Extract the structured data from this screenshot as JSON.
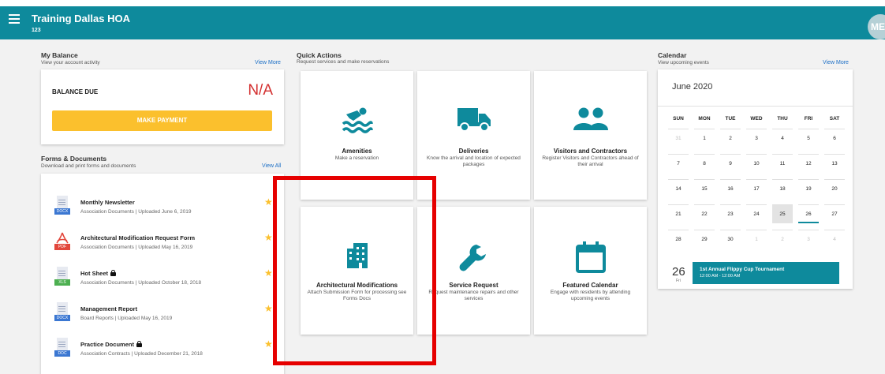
{
  "header": {
    "title": "Training Dallas HOA",
    "subtitle": "123",
    "avatar_initials": "ME"
  },
  "balance": {
    "title": "My Balance",
    "subtitle": "View your account activity",
    "link": "View More",
    "label": "BALANCE DUE",
    "value": "N/A",
    "button": "MAKE PAYMENT"
  },
  "forms": {
    "title": "Forms & Documents",
    "subtitle": "Download and print forms and documents",
    "link": "View All",
    "items": [
      {
        "title": "Monthly Newsletter",
        "meta": "Association Documents | Uploaded June 6, 2019",
        "type": "DOCX",
        "locked": false
      },
      {
        "title": "Architectural Modification Request Form",
        "meta": "Association Documents | Uploaded May 16, 2019",
        "type": "PDF",
        "locked": false
      },
      {
        "title": "Hot Sheet",
        "meta": "Association Documents | Uploaded October 18, 2018",
        "type": "XLS",
        "locked": true
      },
      {
        "title": "Management Report",
        "meta": "Board Reports | Uploaded May 16, 2019",
        "type": "DOCX",
        "locked": false
      },
      {
        "title": "Practice Document",
        "meta": "Association Contracts | Uploaded December 21, 2018",
        "type": "DOC",
        "locked": true
      }
    ]
  },
  "quick_actions": {
    "title": "Quick Actions",
    "subtitle": "Request services and make reservations",
    "tiles": [
      {
        "title": "Amenities",
        "desc": "Make a reservation",
        "icon": "swimming-icon"
      },
      {
        "title": "Deliveries",
        "desc": "Know the arrival and location of expected packages",
        "icon": "truck-icon"
      },
      {
        "title": "Visitors and Contractors",
        "desc": "Register Visitors and Contractors ahead of their arrival",
        "icon": "people-icon"
      },
      {
        "title": "Architectural Modifications",
        "desc": "Attach Submission Form for processing see Forms Docs",
        "icon": "building-icon"
      },
      {
        "title": "Service Request",
        "desc": "Request maintenance repairs and other services",
        "icon": "wrench-icon"
      },
      {
        "title": "Featured Calendar",
        "desc": "Engage with residents by attending upcoming events",
        "icon": "calendar-icon"
      }
    ]
  },
  "calendar": {
    "title": "Calendar",
    "subtitle": "View upcoming events",
    "link": "View More",
    "month": "June 2020",
    "weekdays": [
      "SUN",
      "MON",
      "TUE",
      "WED",
      "THU",
      "FRI",
      "SAT"
    ],
    "weeks": [
      [
        "31",
        "1",
        "2",
        "3",
        "4",
        "5",
        "6"
      ],
      [
        "7",
        "8",
        "9",
        "10",
        "11",
        "12",
        "13"
      ],
      [
        "14",
        "15",
        "16",
        "17",
        "18",
        "19",
        "20"
      ],
      [
        "21",
        "22",
        "23",
        "24",
        "25",
        "26",
        "27"
      ],
      [
        "28",
        "29",
        "30",
        "1",
        "2",
        "3",
        "4"
      ]
    ],
    "muted_cells": [
      "0-0",
      "4-3",
      "4-4",
      "4-5",
      "4-6"
    ],
    "today_cell": "3-4",
    "event_cell": "3-5",
    "event": {
      "day": "26",
      "dow": "Fri",
      "title": "1st Annual Flippy Cup Tournament",
      "time": "12:00 AM - 12:00 AM"
    }
  },
  "colors": {
    "primary": "#0e8a9c",
    "accent": "#fbc02d",
    "danger": "#d32f2f",
    "highlight": "#e60000"
  }
}
